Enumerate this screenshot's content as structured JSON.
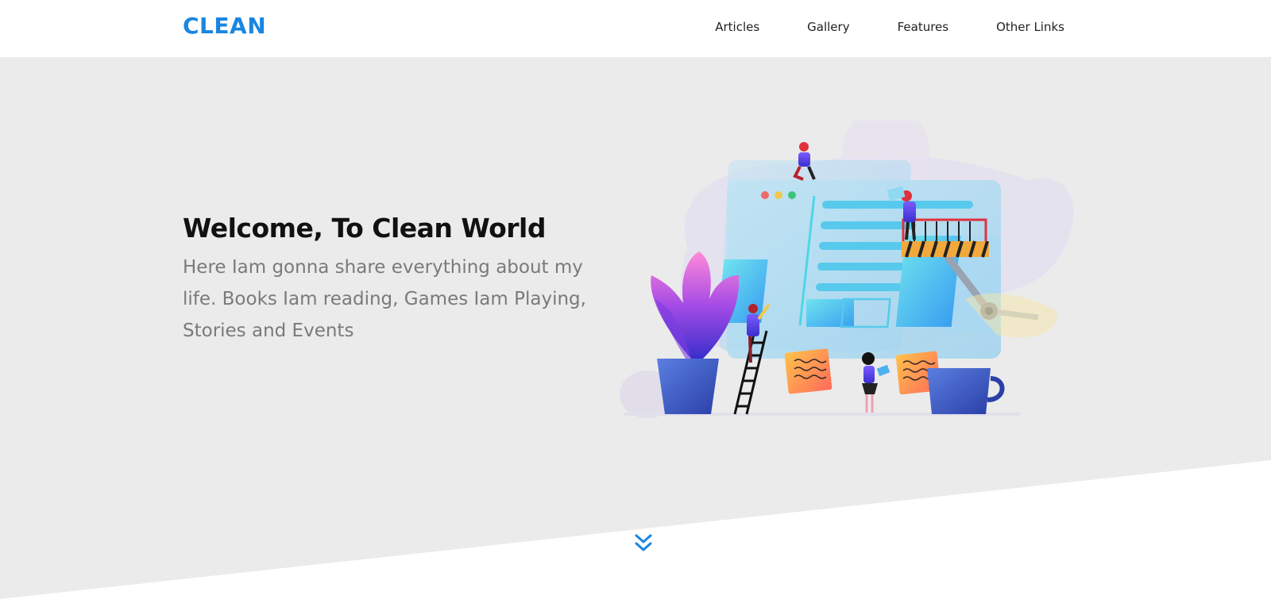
{
  "header": {
    "logo": "CLEAN",
    "nav": [
      {
        "label": "Articles"
      },
      {
        "label": "Gallery"
      },
      {
        "label": "Features"
      },
      {
        "label": "Other Links"
      }
    ]
  },
  "hero": {
    "title": "Welcome, To Clean World",
    "text": "Here Iam gonna share everything about my life. Books Iam reading, Games Iam Playing, Stories and Events"
  },
  "colors": {
    "brand": "#1a86e0",
    "hero_bg": "#ebebeb"
  },
  "icons": {
    "scroll": "double-chevron-down-icon"
  }
}
